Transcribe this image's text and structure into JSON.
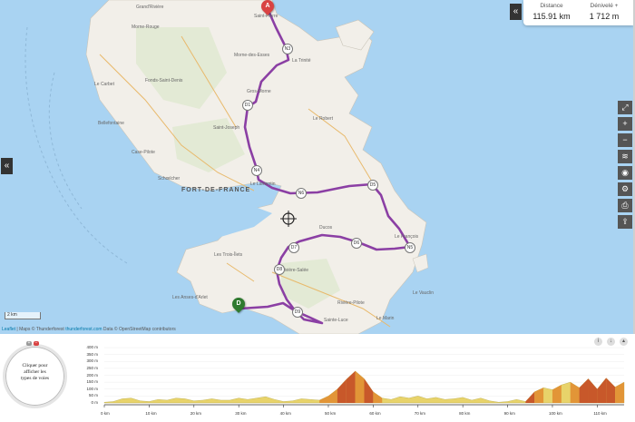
{
  "stats": {
    "distance_label": "Distance",
    "distance_value": "115.91 km",
    "elevation_label": "Dénivelé +",
    "elevation_value": "1 712 m"
  },
  "map": {
    "capital": "FORT-DE-FRANCE",
    "towns": [
      "Saint-Pierre",
      "Le Carbet",
      "Morne-Rouge",
      "Grand'Rivière",
      "Morne-des-Esses",
      "La Trinité",
      "Le Robert",
      "Gros-Morne",
      "Saint-Joseph",
      "Fonds-Saint-Denis",
      "Bellefontaine",
      "Case-Pilote",
      "Schœlcher",
      "Le Lamentin",
      "Ducos",
      "Le François",
      "Rivière-Salée",
      "Les Trois-Îlets",
      "Les Anses-d'Arlet",
      "Rivière-Pilote",
      "Sainte-Luce",
      "Le Marin",
      "Le Vauclin"
    ],
    "route_numbers": [
      "N3",
      "D1",
      "N4",
      "N6",
      "D5",
      "N5",
      "D6",
      "D7",
      "D8",
      "D9"
    ],
    "marker_start": "A",
    "marker_end": "D",
    "scale": "2 km",
    "attribution": {
      "leaflet": "Leaflet",
      "maps": "| Maps © Thunderforest",
      "tf_link": "thunderforest.com",
      "data": "Data © OpenStreetMap contributors"
    },
    "controls": [
      "fullscreen-icon",
      "zoom-in-icon",
      "zoom-out-icon",
      "layers-icon",
      "locate-icon",
      "settings-icon",
      "print-icon",
      "share-icon"
    ],
    "colors": {
      "sea": "#a9d3f2",
      "land": "#f2efe9",
      "route": "#8b3fa4",
      "marker_start": "#d94343",
      "marker_end": "#2f7a2f"
    }
  },
  "profile": {
    "wheel_text": [
      "Cliquer pour",
      "afficher les",
      "types de voies"
    ],
    "y_ticks": [
      "400 m",
      "350 m",
      "300 m",
      "250 m",
      "200 m",
      "150 m",
      "100 m",
      "50 m",
      "0 m"
    ],
    "x_ticks": [
      "0 km",
      "10 km",
      "20 km",
      "30 km",
      "40 km",
      "50 km",
      "60 km",
      "70 km",
      "80 km",
      "90 km",
      "100 km",
      "110 km"
    ]
  },
  "chart_data": {
    "type": "area",
    "xlabel": "",
    "ylabel": "",
    "x": [
      0,
      2,
      4,
      6,
      8,
      10,
      12,
      14,
      16,
      18,
      20,
      22,
      24,
      26,
      28,
      30,
      32,
      34,
      36,
      38,
      40,
      42,
      44,
      46,
      48,
      50,
      52,
      54,
      56,
      58,
      60,
      62,
      64,
      66,
      68,
      70,
      72,
      74,
      76,
      78,
      80,
      82,
      84,
      86,
      88,
      90,
      92,
      94,
      96,
      98,
      100,
      102,
      104,
      106,
      108,
      110,
      112,
      114,
      116
    ],
    "y": [
      5,
      10,
      30,
      35,
      15,
      10,
      25,
      20,
      35,
      30,
      15,
      20,
      30,
      20,
      20,
      35,
      25,
      35,
      45,
      25,
      10,
      15,
      30,
      25,
      20,
      50,
      100,
      170,
      230,
      175,
      80,
      35,
      25,
      45,
      35,
      50,
      30,
      40,
      25,
      30,
      40,
      20,
      35,
      15,
      5,
      10,
      25,
      10,
      80,
      110,
      95,
      130,
      150,
      110,
      175,
      100,
      180,
      115,
      150
    ],
    "xlim": [
      0,
      116
    ],
    "ylim": [
      0,
      400
    ]
  }
}
